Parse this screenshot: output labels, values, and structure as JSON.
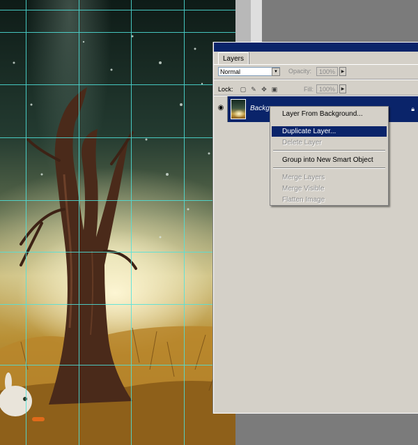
{
  "panel": {
    "tab_label": "Layers",
    "blend_mode": "Normal",
    "opacity_label": "Opacity:",
    "opacity_value": "100%",
    "lock_label": "Lock:",
    "fill_label": "Fill:",
    "fill_value": "100%"
  },
  "layer": {
    "name": "Backgr"
  },
  "context_menu": {
    "items": [
      {
        "label": "Layer From Background...",
        "enabled": true,
        "highlighted": false
      },
      {
        "label": "Duplicate Layer...",
        "enabled": true,
        "highlighted": true
      },
      {
        "label": "Delete Layer",
        "enabled": false,
        "highlighted": false
      },
      {
        "label": "Group into New Smart Object",
        "enabled": true,
        "highlighted": false
      },
      {
        "label": "Merge Layers",
        "enabled": false,
        "highlighted": false
      },
      {
        "label": "Merge Visible",
        "enabled": false,
        "highlighted": false
      },
      {
        "label": "Flatten Image",
        "enabled": false,
        "highlighted": false
      }
    ]
  },
  "colors": {
    "selection": "#0a246a",
    "guide": "#4fe3dc",
    "panel_bg": "#d4d0c8"
  },
  "icons": [
    "eye-icon",
    "lock-transparent-icon",
    "lock-paint-icon",
    "lock-move-icon",
    "lock-all-icon",
    "layer-lock-icon",
    "dropdown-arrow-icon",
    "slider-arrow-icon"
  ]
}
